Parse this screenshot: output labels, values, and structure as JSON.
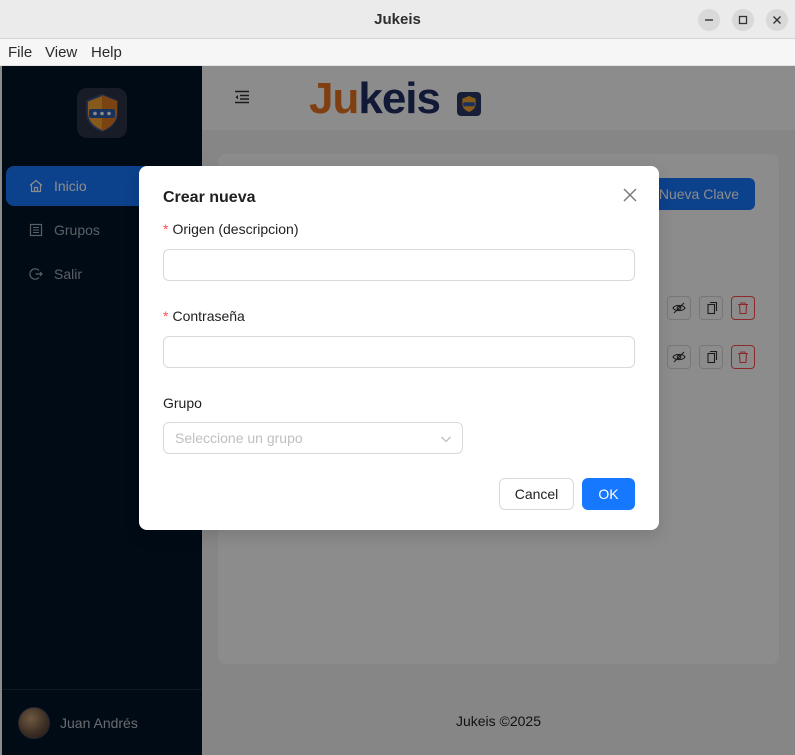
{
  "window": {
    "title": "Jukeis"
  },
  "menu": {
    "file": "File",
    "view": "View",
    "help": "Help"
  },
  "sidebar": {
    "items": [
      {
        "label": "Inicio",
        "icon": "home-icon",
        "active": true
      },
      {
        "label": "Grupos",
        "icon": "group-icon",
        "active": false
      },
      {
        "label": "Salir",
        "icon": "logout-icon",
        "active": false
      }
    ],
    "user_name": "Juan Andrés"
  },
  "header": {
    "brand": {
      "part1": "Ju",
      "part2": "keis"
    }
  },
  "main": {
    "new_button": "Nueva Clave",
    "footer": "Jukeis ©2025"
  },
  "modal": {
    "title": "Crear nueva",
    "fields": {
      "origin_label": "Origen (descripcion)",
      "origin_value": "",
      "password_label": "Contraseña",
      "password_value": "",
      "group_label": "Grupo",
      "group_placeholder": "Seleccione un grupo"
    },
    "cancel": "Cancel",
    "ok": "OK"
  },
  "colors": {
    "primary": "#1677ff",
    "sider": "#001529",
    "brand_orange": "#e8731f",
    "brand_navy": "#1f2f63",
    "danger": "#ff4d4f"
  }
}
